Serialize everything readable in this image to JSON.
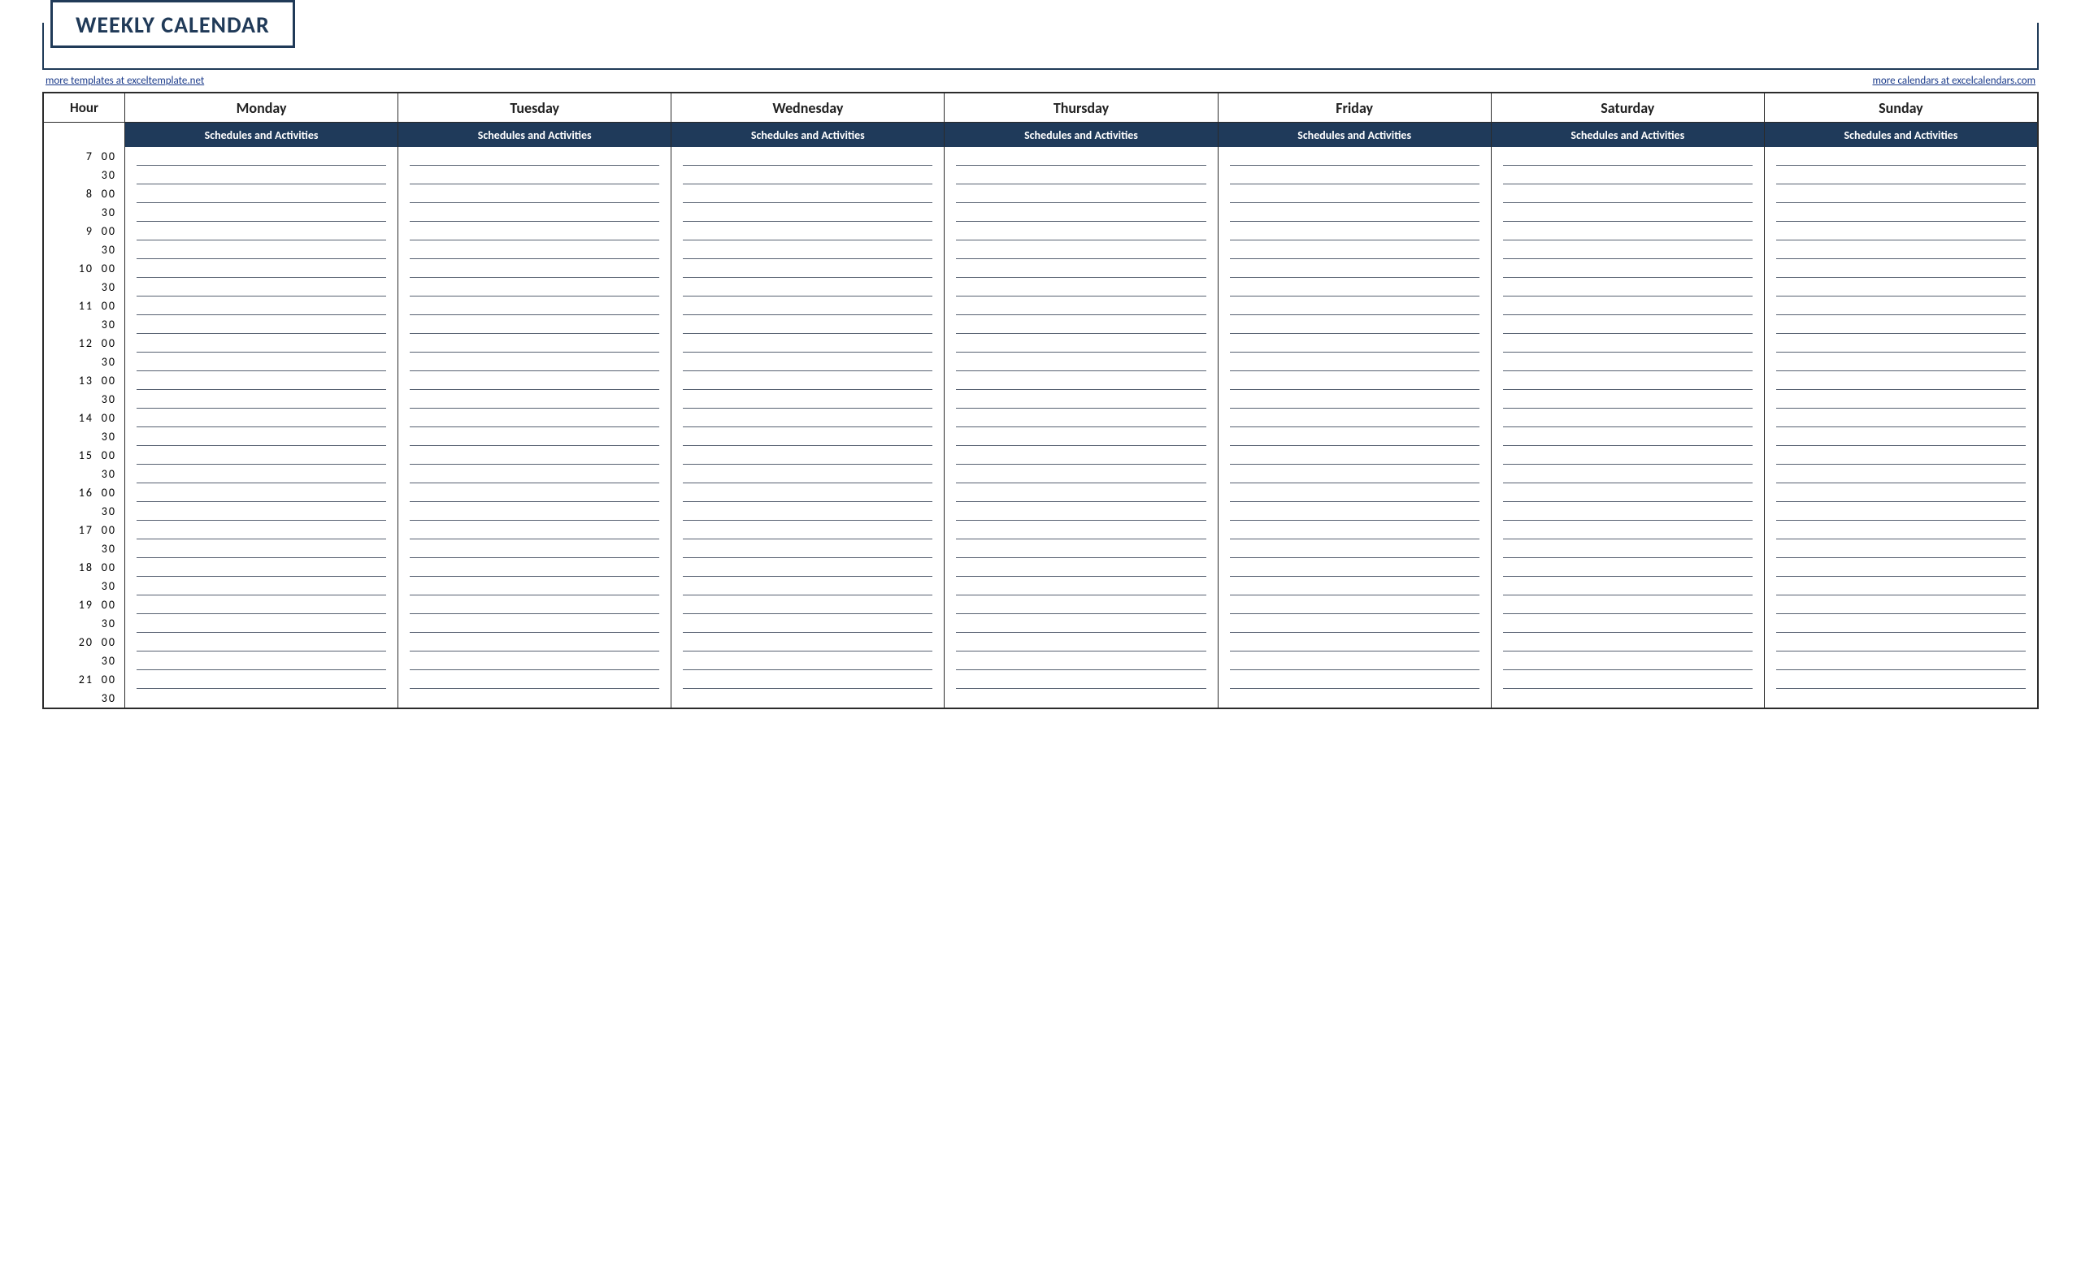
{
  "title": "WEEKLY CALENDAR",
  "links": {
    "left": "more templates at exceltemplate.net",
    "right": "more calendars at excelcalendars.com"
  },
  "header": {
    "hour_label": "Hour",
    "days": [
      "Monday",
      "Tuesday",
      "Wednesday",
      "Thursday",
      "Friday",
      "Saturday",
      "Sunday"
    ],
    "sub_label": "Schedules and Activities"
  },
  "time_slots": [
    {
      "hour": "7",
      "minute": "00"
    },
    {
      "hour": "",
      "minute": "30"
    },
    {
      "hour": "8",
      "minute": "00"
    },
    {
      "hour": "",
      "minute": "30"
    },
    {
      "hour": "9",
      "minute": "00"
    },
    {
      "hour": "",
      "minute": "30"
    },
    {
      "hour": "10",
      "minute": "00"
    },
    {
      "hour": "",
      "minute": "30"
    },
    {
      "hour": "11",
      "minute": "00"
    },
    {
      "hour": "",
      "minute": "30"
    },
    {
      "hour": "12",
      "minute": "00"
    },
    {
      "hour": "",
      "minute": "30"
    },
    {
      "hour": "13",
      "minute": "00"
    },
    {
      "hour": "",
      "minute": "30"
    },
    {
      "hour": "14",
      "minute": "00"
    },
    {
      "hour": "",
      "minute": "30"
    },
    {
      "hour": "15",
      "minute": "00"
    },
    {
      "hour": "",
      "minute": "30"
    },
    {
      "hour": "16",
      "minute": "00"
    },
    {
      "hour": "",
      "minute": "30"
    },
    {
      "hour": "17",
      "minute": "00"
    },
    {
      "hour": "",
      "minute": "30"
    },
    {
      "hour": "18",
      "minute": "00"
    },
    {
      "hour": "",
      "minute": "30"
    },
    {
      "hour": "19",
      "minute": "00"
    },
    {
      "hour": "",
      "minute": "30"
    },
    {
      "hour": "20",
      "minute": "00"
    },
    {
      "hour": "",
      "minute": "30"
    },
    {
      "hour": "21",
      "minute": "00"
    },
    {
      "hour": "",
      "minute": "30"
    }
  ]
}
